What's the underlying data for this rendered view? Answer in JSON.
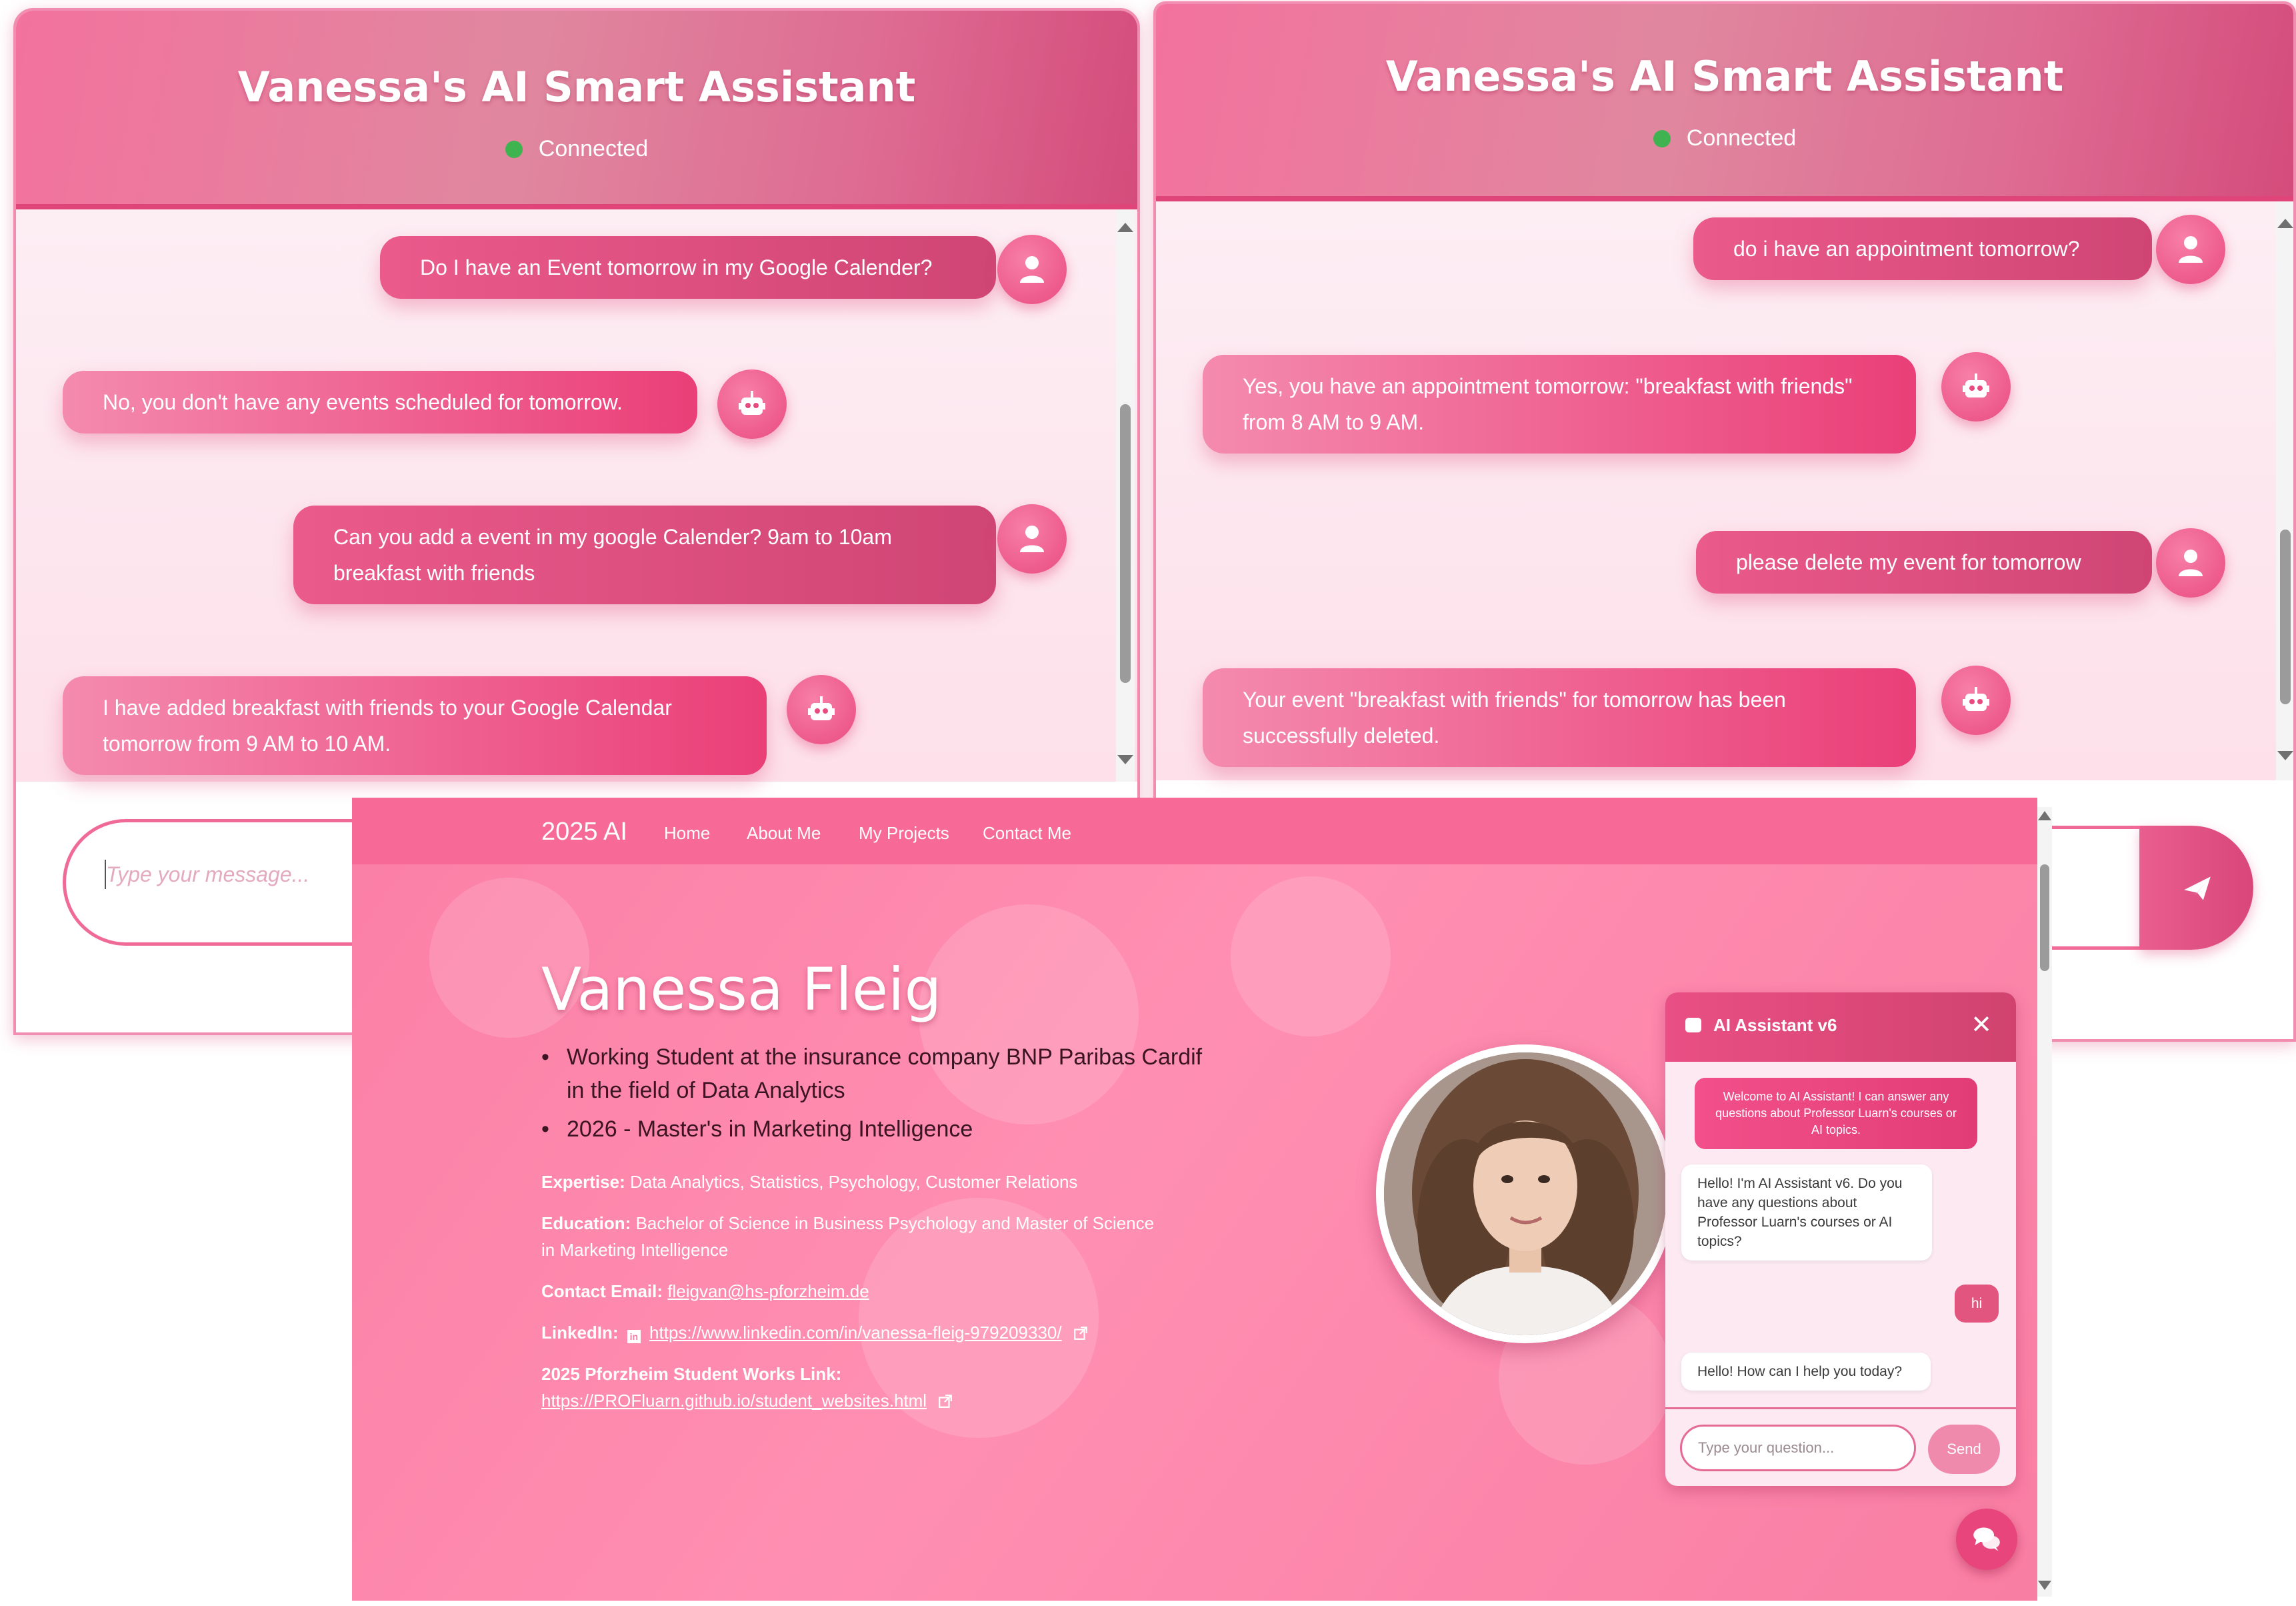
{
  "colors": {
    "accent": "#e94b81",
    "status_green": "#3fb34f",
    "page_pink": "#ff8fb2"
  },
  "left_chat": {
    "title": "Vanessa's AI Smart Assistant",
    "status": "Connected",
    "messages": [
      {
        "role": "user",
        "text": "Do I have an Event tomorrow in my Google Calender?"
      },
      {
        "role": "bot",
        "text": "No, you don't have any events scheduled for tomorrow."
      },
      {
        "role": "user",
        "text": "Can you add a event in my google Calender? 9am to 10am breakfast with friends"
      },
      {
        "role": "bot",
        "text": "I have added breakfast with friends to your Google Calendar tomorrow from 9 AM to 10 AM."
      }
    ],
    "input_placeholder": "Type your message..."
  },
  "right_chat": {
    "title": "Vanessa's AI Smart Assistant",
    "status": "Connected",
    "messages": [
      {
        "role": "user",
        "text": "do i have an appointment tomorrow?"
      },
      {
        "role": "bot",
        "text": "Yes, you have an appointment tomorrow: \"breakfast with friends\" from 8 AM to 9 AM."
      },
      {
        "role": "user",
        "text": "please delete my event for tomorrow"
      },
      {
        "role": "bot",
        "text": "Your event \"breakfast with friends\" for tomorrow has been successfully deleted."
      }
    ]
  },
  "portfolio": {
    "nav": {
      "brand": "2025 AI",
      "links": [
        "Home",
        "About Me",
        "My Projects",
        "Contact Me"
      ]
    },
    "name": "Vanessa Fleig",
    "bullets": [
      "Working Student at the insurance company BNP Paribas Cardif in the field of Data Analytics",
      "2026 - Master's in Marketing Intelligence"
    ],
    "expertise_label": "Expertise:",
    "expertise": "Data Analytics, Statistics, Psychology, Customer Relations",
    "education_label": "Education:",
    "education": "Bachelor of Science in Business Psychology and Master of Science in Marketing Intelligence",
    "email_label": "Contact Email:",
    "email": "fleigvan@hs-pforzheim.de",
    "linkedin_label": "LinkedIn:",
    "linkedin_url": "https://www.linkedin.com/in/vanessa-fleig-979209330/",
    "works_label": "2025 Pforzheim Student Works Link:",
    "works_url": "https://PROFluarn.github.io/student_websites.html"
  },
  "widget": {
    "title": "AI Assistant v6",
    "close": "✕",
    "welcome": "Welcome to AI Assistant! I can answer any questions about Professor Luarn's courses or AI topics.",
    "bot_1": "Hello! I'm AI Assistant v6. Do you have any questions about Professor Luarn's courses or AI topics?",
    "user_1": "hi",
    "bot_2": "Hello! How can I help you today?",
    "input_placeholder": "Type your question...",
    "send_label": "Send"
  }
}
